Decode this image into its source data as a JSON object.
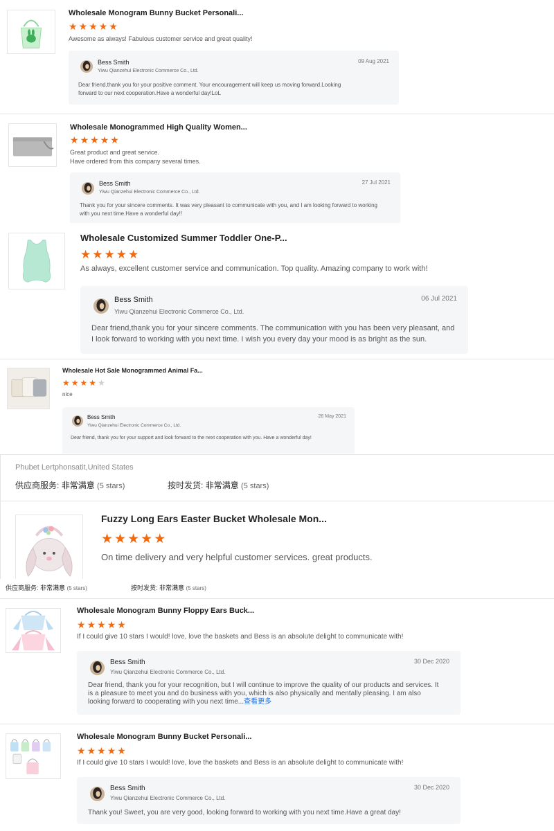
{
  "colors": {
    "star": "#f26a10",
    "star_off": "#cfcfcf",
    "link": "#1a73e8",
    "reply_bg": "#f5f6f8"
  },
  "reviews": [
    {
      "thumb_icon": "bunny-bucket-icon",
      "title": "Wholesale Monogram Bunny Bucket Personali...",
      "rating": 5,
      "comment": "Awesome as always! Fabulous customer service and great quality!",
      "reply": {
        "name": "Bess Smith",
        "company": "Yiwu Qianzehui Electronic Commerce Co., Ltd.",
        "date": "09 Aug 2021",
        "text": "Dear friend,thank you for your positive comment. Your encouragement will keep us moving forward.Looking forward to our next cooperation.Have a wonderful day!LoL"
      }
    },
    {
      "thumb_icon": "clutch-bag-icon",
      "title": "Wholesale Monogrammed High Quality Women...",
      "rating": 5,
      "comment": "Great product and great service.",
      "comment2": "Have ordered from this company several times.",
      "reply": {
        "name": "Bess Smith",
        "company": "Yiwu Qianzehui Electronic Commerce Co., Ltd.",
        "date": "27 Jul 2021",
        "text": "Thank you for your sincere comments. It was very pleasant to communicate with you, and I am looking forward to working with you next time.Have a wonderful day!!"
      }
    },
    {
      "thumb_icon": "toddler-romper-icon",
      "title": "Wholesale Customized Summer Toddler One-P...",
      "rating": 5,
      "comment": "As always, excellent customer service and communication. Top quality. Amazing company to work with!",
      "reply": {
        "name": "Bess Smith",
        "company": "Yiwu Qianzehui Electronic Commerce Co., Ltd.",
        "date": "06 Jul 2021",
        "text": "Dear friend,thank you for your sincere comments. The communication with you has been very pleasant, and I look forward to working with you next time. I wish you every day your mood is as bright as the sun."
      }
    },
    {
      "thumb_icon": "pillow-covers-icon",
      "title": "Wholesale Hot Sale Monogrammed Animal Fa...",
      "rating": 4,
      "comment": "nice",
      "reply": {
        "name": "Bess Smith",
        "company": "Yiwu Qianzehui Electronic Commerce Co., Ltd.",
        "date": "26 May 2021",
        "text": "Dear friend, thank you for your support and look forward to the next cooperation with you. Have a wonderful day!"
      }
    },
    {
      "reviewer": "Phubet Lertphonsatit,United States",
      "supplier_label": "供应商服务:",
      "supplier_value": "非常满意",
      "supplier_stars": "(5 stars)",
      "delivery_label": "按时发货:",
      "delivery_value": "非常满意",
      "delivery_stars": "(5 stars)",
      "thumb_icon": "fuzzy-bunny-bucket-icon",
      "title": "Fuzzy Long Ears Easter Bucket Wholesale Mon...",
      "rating": 5,
      "comment": "On time delivery and very helpful customer services. great products."
    },
    {
      "supplier_label": "供应商服务:",
      "supplier_value": "非常满意",
      "supplier_stars": "(5 stars)",
      "delivery_label": "按时发货:",
      "delivery_value": "非常满意",
      "delivery_stars": "(5 stars)"
    },
    {
      "thumb_icon": "floppy-ears-bucket-icon",
      "title": "Wholesale Monogram Bunny Floppy Ears Buck...",
      "rating": 5,
      "comment": "If I could give 10 stars I would! love, love the baskets and Bess is an absolute delight to communicate with!",
      "reply": {
        "name": "Bess Smith",
        "company": "Yiwu Qianzehui Electronic Commerce Co., Ltd.",
        "date": "30 Dec 2020",
        "text": "Dear friend, thank you for your recognition, but I will continue to improve the quality of our products and services. It is a pleasure to meet you and do business with you, which is also physically and mentally pleasing. I am also looking forward to cooperating with you next time...",
        "more": "查看更多"
      }
    },
    {
      "thumb_icon": "bunny-buckets-set-icon",
      "title": "Wholesale Monogram Bunny Bucket Personali...",
      "rating": 5,
      "comment": "If I could give 10 stars I would! love, love the baskets and Bess is an absolute delight to communicate with!",
      "reply": {
        "name": "Bess Smith",
        "company": "Yiwu Qianzehui Electronic Commerce Co., Ltd.",
        "date": "30 Dec 2020",
        "text": "Thank you! Sweet, you are very good, looking forward to working with you next time.Have a  great day!"
      }
    }
  ]
}
